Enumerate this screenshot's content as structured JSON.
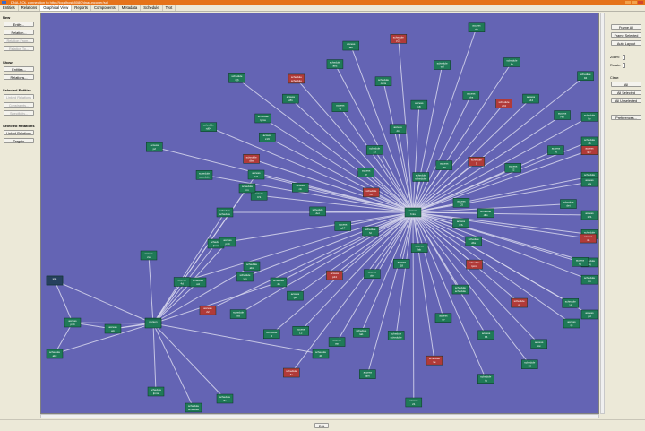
{
  "window": {
    "title": "DNA-SQL connection to http://localhost:8080/dna/uncover/sql"
  },
  "menu": {
    "tabs": [
      "Entities",
      "Relations",
      "Graphical View",
      "Reports",
      "Components",
      "Metadata",
      "Schedule",
      "Text"
    ]
  },
  "left": {
    "new_title": "New",
    "entity_btn": "Entity...",
    "relation_btn": "Relation...",
    "relation_from_btn": "Relation From...",
    "relation_to_btn": "Relation To...",
    "show_title": "Show",
    "entities_btn": "Entities...",
    "relations_btn": "Relations...",
    "selected_entities_title": "Selected Entities",
    "linked_relations_btn": "Linked Relations",
    "constraints_btn": "Constraints...",
    "specificity_btn": "Specificity...",
    "selected_relations_title": "Selected Relations",
    "linked_relations2_btn": "Linked Relations",
    "targets_btn": "Targets"
  },
  "right": {
    "frame_all": "Frame All",
    "frame_selected": "Frame Selected",
    "auto_layout": "Auto Layout",
    "zoom_label": "Zoom:",
    "rotate_label": "Rotate:",
    "clear_label": "Clear:",
    "all_btn": "All",
    "all_selected_btn": "All Selected",
    "all_unselected_btn": "All Unselected",
    "preferences_btn": "Preferences..."
  },
  "status": {
    "exit_label": "Exit"
  },
  "colors": {
    "canvas": "#6464b4",
    "node_green": "#1f7a57",
    "node_red": "#b13a38",
    "node_dark": "#25405d",
    "edge": "#d8d8ee"
  },
  "graph": {
    "hub_label": "access fmts",
    "secondary_hub_label": "person",
    "root_label": "site",
    "node_labels": [
      "access CS",
      "schedule schedule",
      "access p2",
      "schedule dbs",
      "schedule rd04",
      "access x19",
      "schedule lpms",
      "schedule x(l)",
      "access x81",
      "schedule schedule",
      "access vt",
      "schedule abc",
      "access lab",
      "schedule cons",
      "schedule p21",
      "access 18",
      "schedule vol",
      "access rtb",
      "access obs",
      "schedule lib",
      "schedule ch3",
      "access p44",
      "schedule 94",
      "access HB",
      "schedule hz",
      "access 2v",
      "schedule 4b",
      "access g17",
      "schedule ac",
      "access wa",
      "schedule det",
      "access 121",
      "schedule pl",
      "access nb",
      "schedule sq",
      "access xy",
      "schedule rm",
      "access pd",
      "schedule 16",
      "access rp",
      "schedule gt",
      "access cw",
      "schedule 33",
      "access b6",
      "schedule tq",
      "access dv",
      "schedule 3e",
      "access 21",
      "schedule scheduler",
      "access ops",
      "schedule lab",
      "access wp",
      "schedule fin",
      "access 12",
      "schedule 5",
      "access go",
      "schedule 8a",
      "access 22",
      "schedule vm",
      "access 4d"
    ]
  }
}
